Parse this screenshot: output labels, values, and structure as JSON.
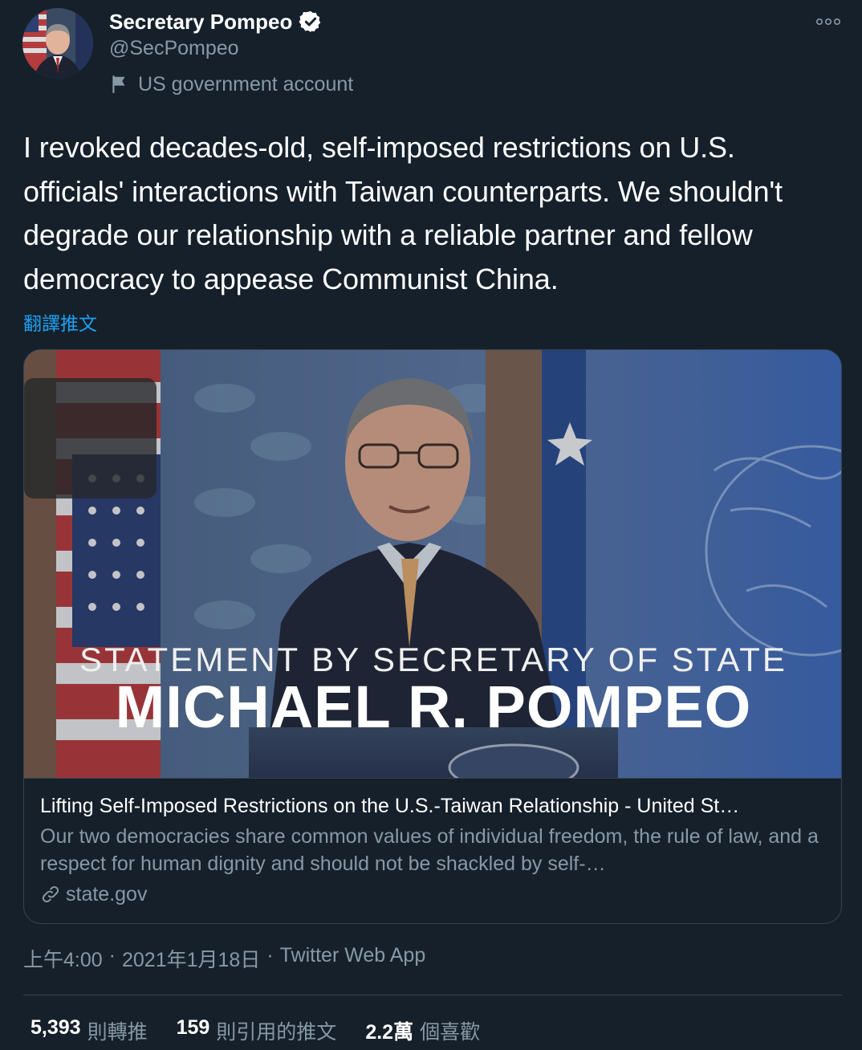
{
  "author": {
    "display_name": "Secretary Pompeo",
    "handle": "@SecPompeo",
    "label": "US government account",
    "verified_icon": "verified-badge-icon",
    "more_icon": "more-options-icon"
  },
  "tweet": {
    "text": "I revoked decades-old, self-imposed restrictions on U.S. officials' interactions with Taiwan counterparts. We shouldn't degrade our relationship with a reliable partner and fellow democracy to appease Communist China.",
    "translate_label": "翻譯推文"
  },
  "card": {
    "image_text_top": "STATEMENT BY SECRETARY OF STATE",
    "image_text_main": "MICHAEL R. POMPEO",
    "title": "Lifting Self-Imposed Restrictions on the U.S.-Taiwan Relationship - United St…",
    "description": "Our two democracies share common values of individual freedom, the rule of law, and a respect for human dignity and should not be shackled by self-…",
    "domain": "state.gov"
  },
  "meta": {
    "time": "上午4:00",
    "separator": "·",
    "date": "2021年1月18日",
    "source": "Twitter Web App"
  },
  "stats": {
    "retweets_count": "5,393",
    "retweets_label": "則轉推",
    "quotes_count": "159",
    "quotes_label": "則引用的推文",
    "likes_count": "2.2萬",
    "likes_label": "個喜歡"
  },
  "colors": {
    "background": "#15202b",
    "secondary_text": "#8899a6",
    "link": "#1da1f2",
    "border": "#38444d"
  }
}
